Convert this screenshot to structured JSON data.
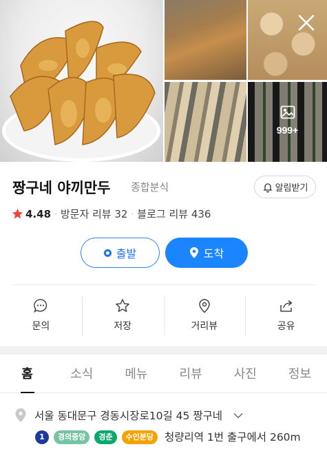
{
  "photos": {
    "more_count": "999+",
    "icons": {
      "close": "close-icon",
      "gallery": "image-icon"
    }
  },
  "place": {
    "name": "짱구네 야끼만두",
    "category": "종합분식",
    "alarm_label": "알림받기",
    "rating": "4.48",
    "visitor_review": "방문자 리뷰 32",
    "blog_review": "블로그 리뷰 436",
    "star_color": "#e8453c"
  },
  "route": {
    "start_label": "출발",
    "arrive_label": "도착",
    "accent": "#1a85ff"
  },
  "quick_actions": [
    {
      "label": "문의",
      "icon": "chat-icon"
    },
    {
      "label": "저장",
      "icon": "star-icon"
    },
    {
      "label": "거리뷰",
      "icon": "location-pin-icon"
    },
    {
      "label": "공유",
      "icon": "share-icon"
    }
  ],
  "tabs": [
    "홈",
    "소식",
    "메뉴",
    "리뷰",
    "사진",
    "정보"
  ],
  "active_tab": "홈",
  "info": {
    "address": "서울 동대문구 경동시장로10길 45 짱구네",
    "subway_lines": [
      {
        "label": "1",
        "color": "#1d3a9c"
      },
      {
        "label": "경의중앙",
        "color": "#77c4a3"
      },
      {
        "label": "경춘",
        "color": "#0aa86c"
      },
      {
        "label": "수인분당",
        "color": "#f5a200"
      }
    ],
    "directions": "청량리역 1번 출구에서 260m"
  }
}
